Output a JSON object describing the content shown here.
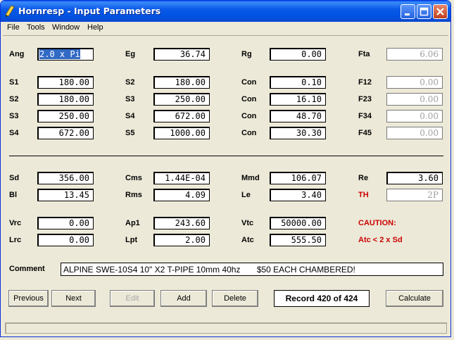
{
  "window": {
    "title": "Hornresp - Input Parameters"
  },
  "menu": {
    "file": "File",
    "tools": "Tools",
    "window": "Window",
    "help": "Help"
  },
  "params": {
    "ang": {
      "label": "Ang",
      "value": "2.0 x Pi"
    },
    "eg": {
      "label": "Eg",
      "value": "36.74"
    },
    "rg": {
      "label": "Rg",
      "value": "0.00"
    },
    "fta": {
      "label": "Fta",
      "value": "6.06"
    },
    "s1a": {
      "label": "S1",
      "value": "180.00"
    },
    "s2a": {
      "label": "S2",
      "value": "180.00"
    },
    "con1": {
      "label": "Con",
      "value": "0.10"
    },
    "f12": {
      "label": "F12",
      "value": "0.00"
    },
    "s2b": {
      "label": "S2",
      "value": "180.00"
    },
    "s3a": {
      "label": "S3",
      "value": "250.00"
    },
    "con2": {
      "label": "Con",
      "value": "16.10"
    },
    "f23": {
      "label": "F23",
      "value": "0.00"
    },
    "s3b": {
      "label": "S3",
      "value": "250.00"
    },
    "s4a": {
      "label": "S4",
      "value": "672.00"
    },
    "con3": {
      "label": "Con",
      "value": "48.70"
    },
    "f34": {
      "label": "F34",
      "value": "0.00"
    },
    "s4b": {
      "label": "S4",
      "value": "672.00"
    },
    "s5": {
      "label": "S5",
      "value": "1000.00"
    },
    "con4": {
      "label": "Con",
      "value": "30.30"
    },
    "f45": {
      "label": "F45",
      "value": "0.00"
    },
    "sd": {
      "label": "Sd",
      "value": "356.00"
    },
    "cms": {
      "label": "Cms",
      "value": "1.44E-04"
    },
    "mmd": {
      "label": "Mmd",
      "value": "106.07"
    },
    "re": {
      "label": "Re",
      "value": "3.60"
    },
    "bl": {
      "label": "Bl",
      "value": "13.45"
    },
    "rms": {
      "label": "Rms",
      "value": "4.09"
    },
    "le": {
      "label": "Le",
      "value": "3.40"
    },
    "th": {
      "label": "TH",
      "value": "2P"
    },
    "vrc": {
      "label": "Vrc",
      "value": "0.00"
    },
    "ap1": {
      "label": "Ap1",
      "value": "243.60"
    },
    "vtc": {
      "label": "Vtc",
      "value": "50000.00"
    },
    "lrc": {
      "label": "Lrc",
      "value": "0.00"
    },
    "lpt": {
      "label": "Lpt",
      "value": "2.00"
    },
    "atc": {
      "label": "Atc",
      "value": "555.50"
    }
  },
  "caution": {
    "title": "CAUTION:",
    "message": "Atc < 2 x Sd"
  },
  "comment": {
    "label": "Comment",
    "value": "ALPINE SWE-10S4 10\" X2 T-PIPE 10mm 40hz       $50 EACH CHAMBERED!"
  },
  "buttons": {
    "previous": "Previous",
    "next": "Next",
    "edit": "Edit",
    "add": "Add",
    "delete": "Delete",
    "calculate": "Calculate"
  },
  "record": "Record 420 of 424",
  "colors": {
    "caution": "#cc0000",
    "titlebar": "#0054e3",
    "selection": "#316ac5"
  }
}
